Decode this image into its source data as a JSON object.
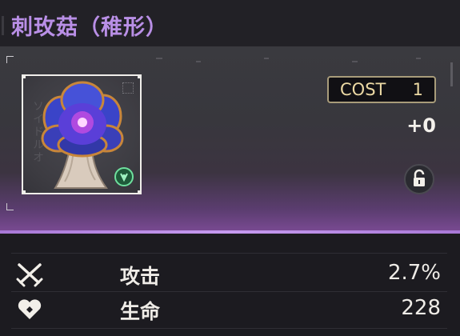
{
  "header": {
    "title": "刺玫菇（稚形）"
  },
  "card": {
    "thumbnail_side_text": "ソイドルオ",
    "element_icon": "anemo-element-icon",
    "cost_label": "COST",
    "cost_value": "1",
    "level": "+0",
    "lock_icon": "unlock-icon"
  },
  "stats": [
    {
      "icon": "sword-crossed-icon",
      "label": "攻击",
      "value": "2.7%"
    },
    {
      "icon": "heart-icon",
      "label": "生命",
      "value": "228"
    }
  ],
  "colors": {
    "title": "#b98fe6",
    "accent": "#c69bf0",
    "cost_border": "#a89c7a",
    "element": "#6ee09e"
  }
}
